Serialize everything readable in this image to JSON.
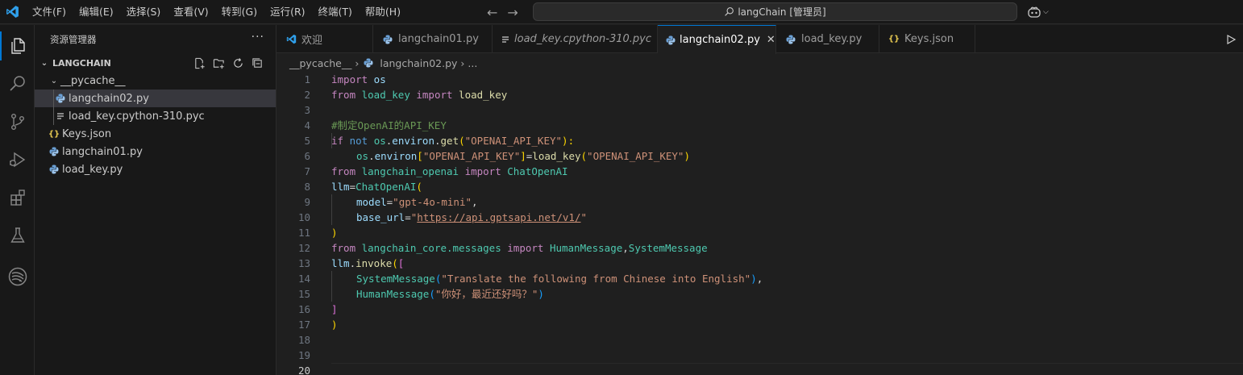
{
  "titlebar": {
    "menus": [
      "文件(F)",
      "编辑(E)",
      "选择(S)",
      "查看(V)",
      "转到(G)",
      "运行(R)",
      "终端(T)",
      "帮助(H)"
    ],
    "search_text": "langChain [管理员]"
  },
  "activity_icons": [
    "explorer-icon",
    "search-icon",
    "source-control-icon",
    "run-debug-icon",
    "extensions-icon",
    "testing-icon",
    "remote-icon"
  ],
  "sidebar": {
    "title": "资源管理器",
    "section": "LANGCHAIN",
    "tree": [
      {
        "label": "__pycache__",
        "type": "folder"
      },
      {
        "label": "langchain02.py",
        "type": "python"
      },
      {
        "label": "load_key.cpython-310.pyc",
        "type": "pyc"
      },
      {
        "label": "Keys.json",
        "type": "json"
      },
      {
        "label": "langchain01.py",
        "type": "python"
      },
      {
        "label": "load_key.py",
        "type": "python"
      }
    ]
  },
  "tabs": [
    {
      "label": "欢迎",
      "type": "vscode"
    },
    {
      "label": "langchain01.py",
      "type": "python"
    },
    {
      "label": "load_key.cpython-310.pyc",
      "type": "pyc"
    },
    {
      "label": "langchain02.py",
      "type": "python",
      "active": true
    },
    {
      "label": "load_key.py",
      "type": "python"
    },
    {
      "label": "Keys.json",
      "type": "json"
    }
  ],
  "breadcrumb": {
    "folder": "__pycache__",
    "file": "langchain02.py",
    "tail": "..."
  },
  "editor": {
    "current_line": 20,
    "line_numbers": [
      "1",
      "2",
      "3",
      "4",
      "5",
      "6",
      "7",
      "8",
      "9",
      "10",
      "11",
      "12",
      "13",
      "14",
      "15",
      "16",
      "17",
      "18",
      "19",
      "20"
    ],
    "code": {
      "l1": [
        "import",
        " os"
      ],
      "l2": [
        "from",
        " load_key ",
        "import",
        " load_key"
      ],
      "l4": "#制定OpenAI的API_KEY",
      "l5": [
        "if",
        " not ",
        "os",
        ".",
        "environ",
        ".",
        "get",
        "(",
        "\"OPENAI_API_KEY\"",
        "):"
      ],
      "l6": [
        "os",
        ".",
        "environ",
        "[",
        "\"OPENAI_API_KEY\"",
        "]",
        "=",
        "load_key",
        "(",
        "\"OPENAI_API_KEY\"",
        ")"
      ],
      "l7": [
        "from",
        " langchain_openai ",
        "import",
        " ChatOpenAI"
      ],
      "l8": [
        "llm",
        "=",
        "ChatOpenAI",
        "("
      ],
      "l9": [
        "model",
        "=",
        "\"gpt-4o-mini\"",
        ","
      ],
      "l10": [
        "base_url",
        "=",
        "\"",
        "https://api.gptsapi.net/v1/",
        "\""
      ],
      "l11": ")",
      "l12": [
        "from",
        " langchain_core.messages ",
        "import",
        " HumanMessage",
        ",",
        "SystemMessage"
      ],
      "l13": [
        "llm",
        ".",
        "invoke",
        "(",
        "["
      ],
      "l14": [
        "SystemMessage",
        "(",
        "\"Translate the following from Chinese into English\"",
        ")",
        ","
      ],
      "l15": [
        "HumanMessage",
        "(",
        "\"你好，最近还好吗？\"",
        ")"
      ],
      "l16": "]",
      "l17": ")"
    }
  },
  "colors": {
    "accent": "#0078d4",
    "editor_bg": "#1f1f1f",
    "sidebar_bg": "#181818"
  }
}
